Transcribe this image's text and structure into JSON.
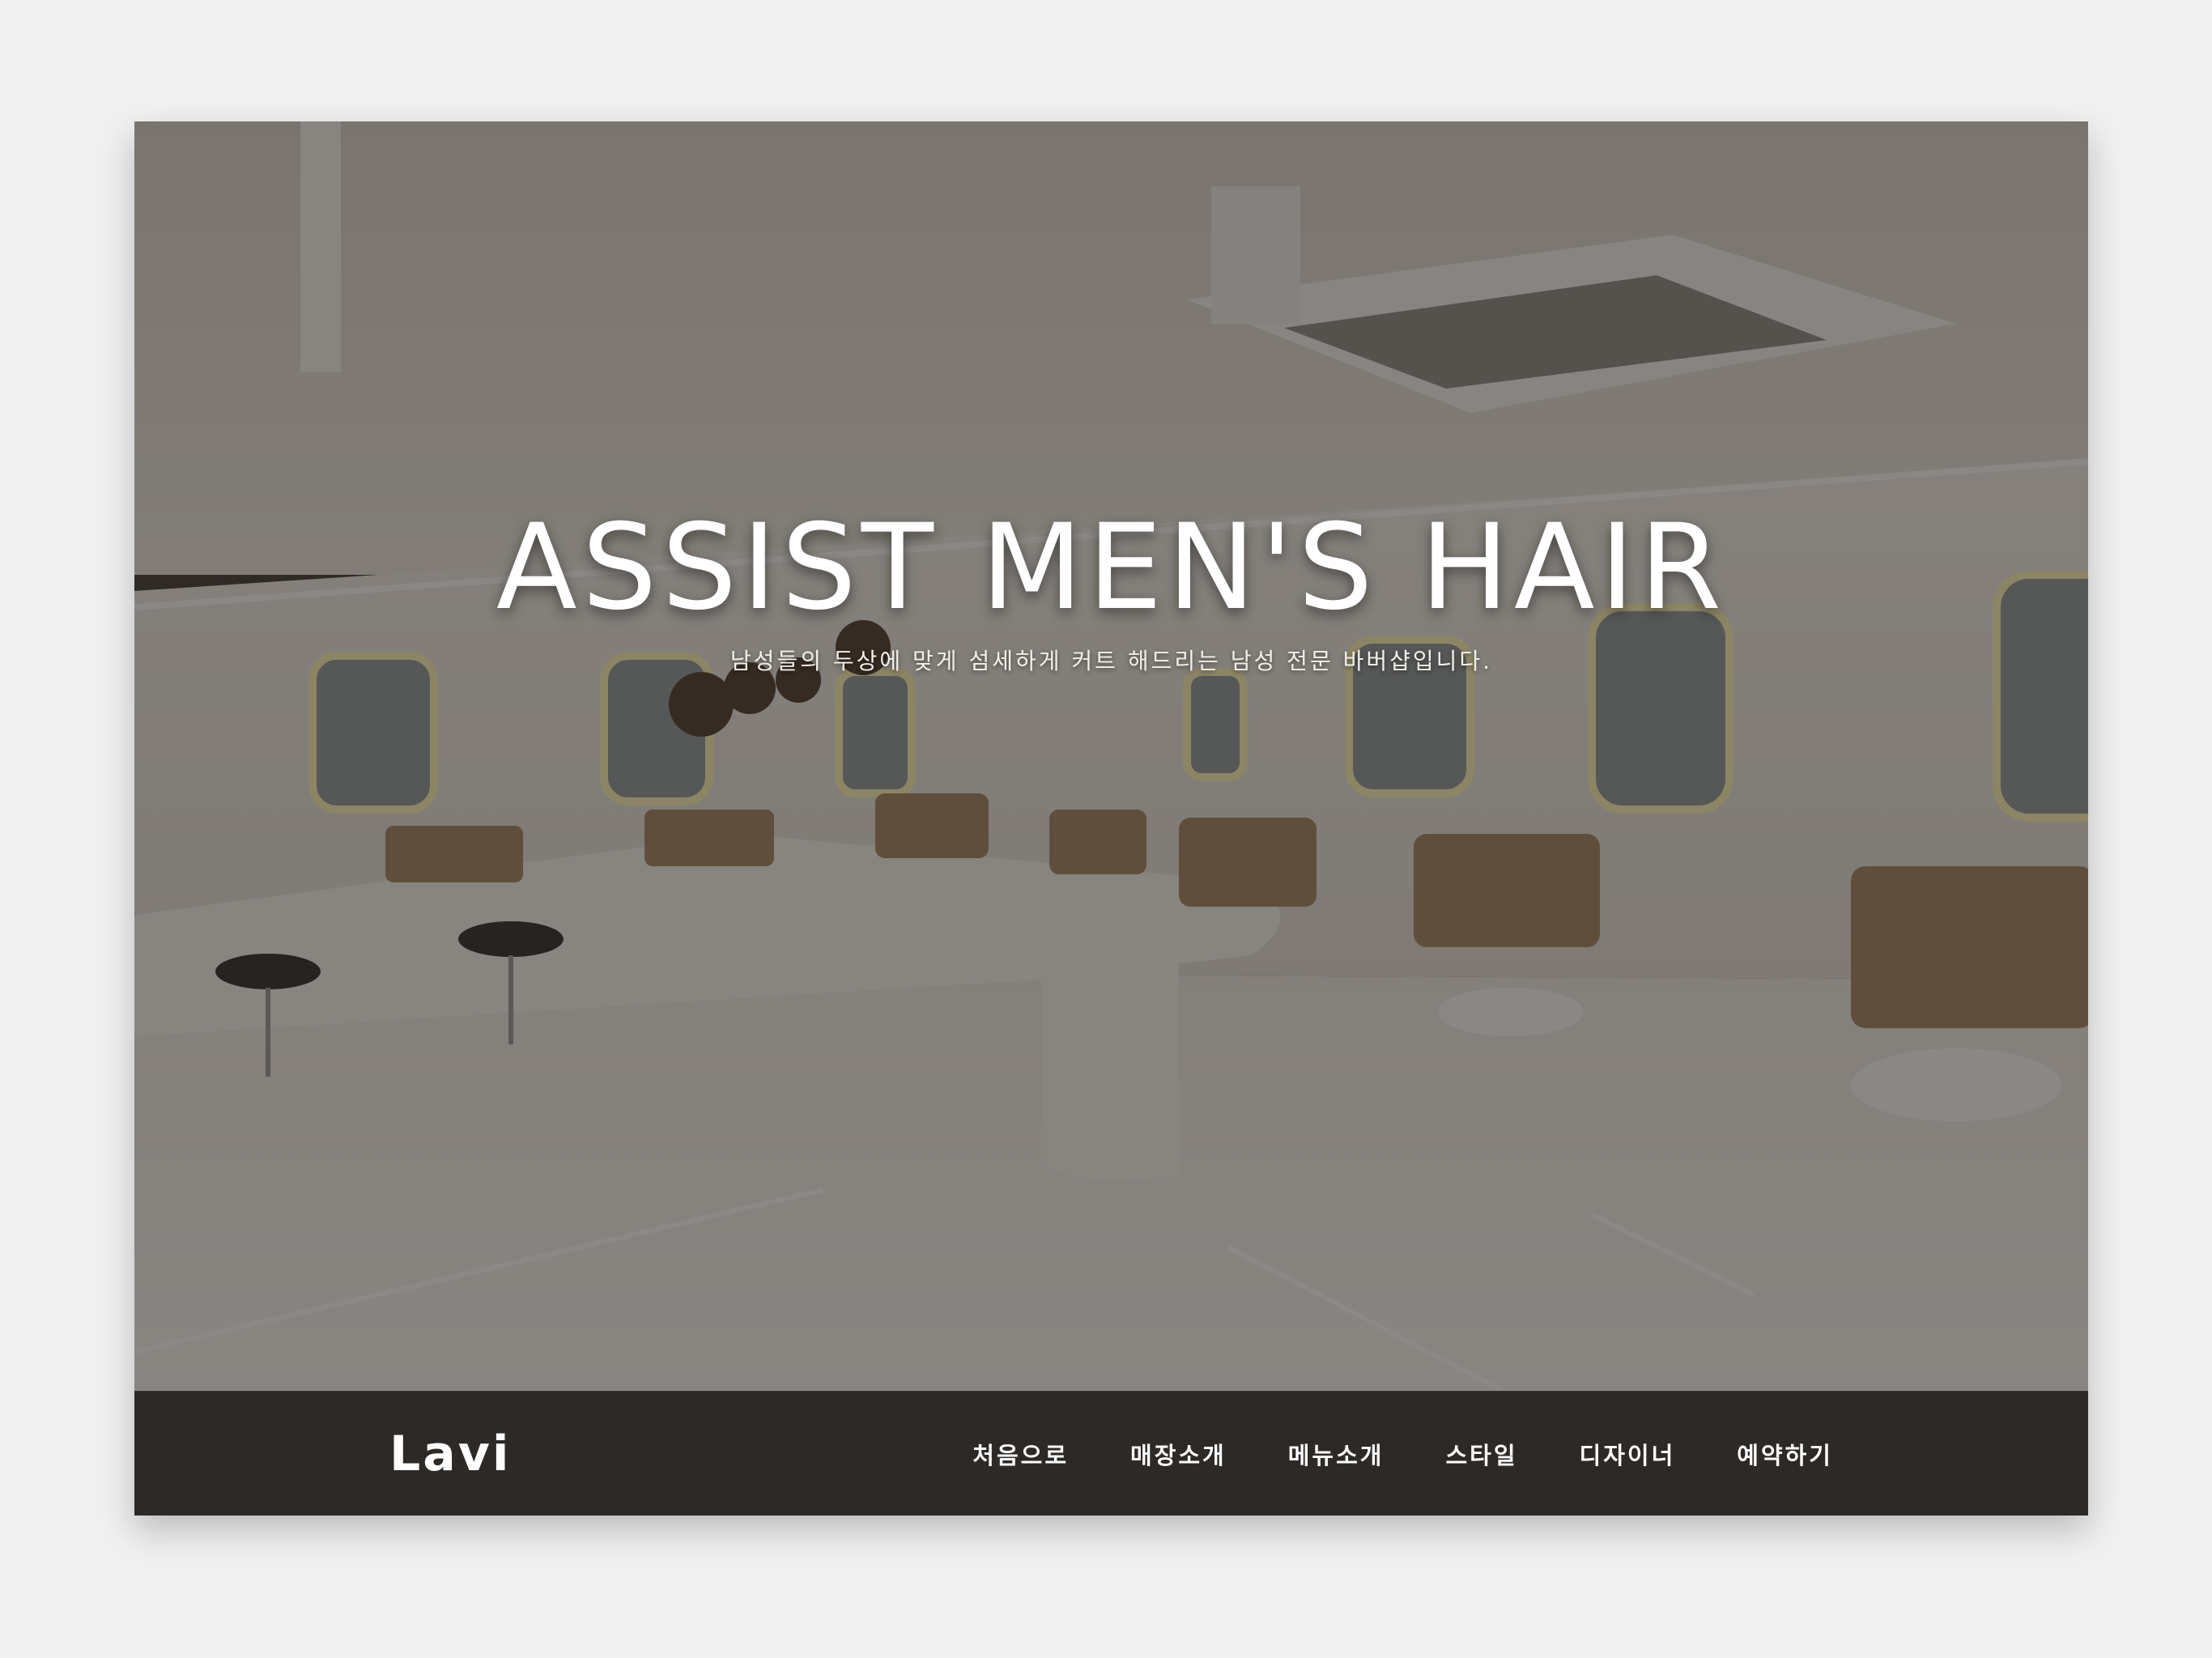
{
  "hero": {
    "image_alt": "barbershop interior",
    "headline": "ASSIST MEN'S HAIR",
    "subheadline": "남성들의 두상에 맞게 섬세하게 커트 해드리는 남성 전문 바버샵입니다."
  },
  "nav": {
    "logo": "Lavi",
    "items": [
      {
        "label": "처음으로"
      },
      {
        "label": "매장소개"
      },
      {
        "label": "메뉴소개"
      },
      {
        "label": "스타일"
      },
      {
        "label": "디자이너"
      },
      {
        "label": "예약하기"
      }
    ]
  },
  "colors": {
    "page_background": "#f0f0f0",
    "overlay": "#221c18",
    "navbar": "#2c2826",
    "text": "#ffffff"
  }
}
